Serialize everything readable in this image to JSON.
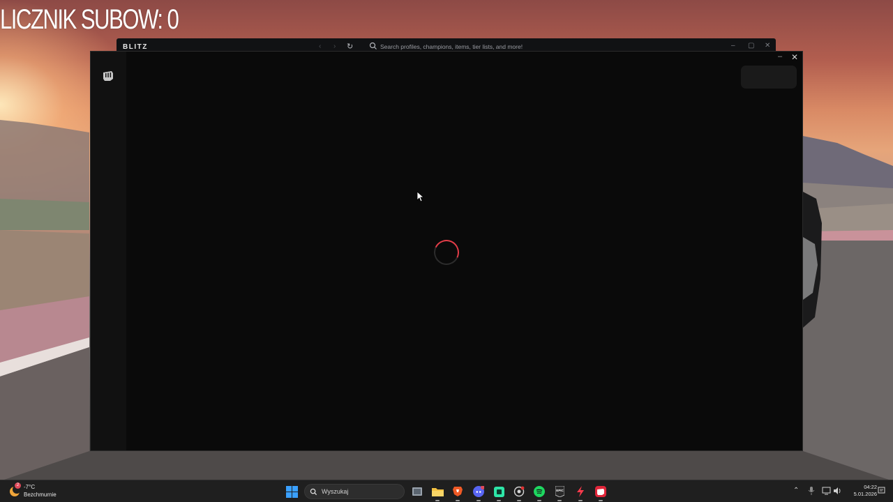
{
  "overlay": {
    "counter_text": "LICZNIK SUBOW: 0"
  },
  "background_window": {
    "brand": "BLITZ",
    "search_placeholder": "Search profiles, champions, items, tier lists, and more!"
  },
  "foreground_window": {
    "loading": true,
    "accent_color": "#e23d48"
  },
  "taskbar": {
    "weather": {
      "temperature": "-7°C",
      "description": "Bezchmurnie",
      "badge": "2"
    },
    "search_label": "Wyszukaj",
    "apps": [
      {
        "name": "file-explorer-stack",
        "icon": "task-view-icon"
      },
      {
        "name": "file-explorer",
        "icon": "folder-icon"
      },
      {
        "name": "brave-browser",
        "icon": "brave-icon"
      },
      {
        "name": "discord",
        "icon": "discord-icon",
        "badge": "2"
      },
      {
        "name": "app-green",
        "icon": "app-icon"
      },
      {
        "name": "obs",
        "icon": "record-icon"
      },
      {
        "name": "spotify",
        "icon": "spotify-icon"
      },
      {
        "name": "epic-games",
        "icon": "epic-icon",
        "label": "EPIC"
      },
      {
        "name": "blitz-lightning",
        "icon": "lightning-icon"
      },
      {
        "name": "riot-client",
        "icon": "riot-icon"
      }
    ],
    "clock": {
      "time": "04:22",
      "date": "5.01.2026"
    }
  }
}
